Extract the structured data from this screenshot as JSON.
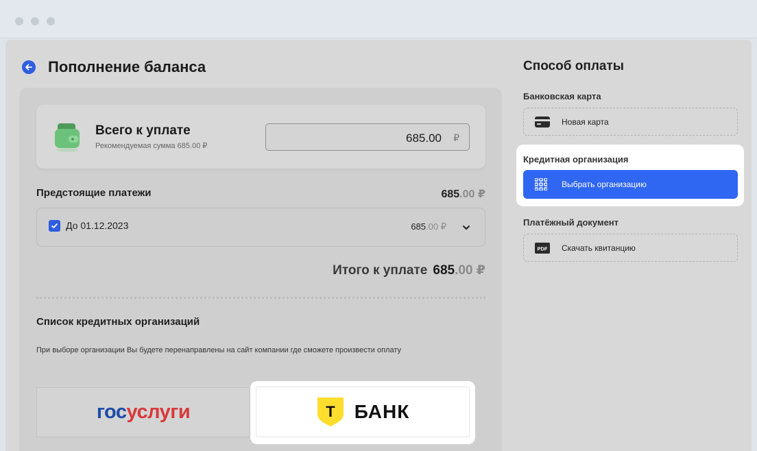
{
  "window": {
    "controls": [
      "close",
      "minimize",
      "maximize"
    ]
  },
  "colors": {
    "accent": "#2f66f2",
    "brand_blue": "#1e4aa8",
    "brand_red": "#d9393a",
    "tbank_yellow": "#ffdd2d"
  },
  "header": {
    "title": "Пополнение баланса",
    "back_icon": "arrow-left-icon"
  },
  "total_card": {
    "icon": "wallet-icon",
    "title": "Всего к уплате",
    "subtitle": "Рекомендуемая сумма 685.00 ₽",
    "amount_value": "685.00",
    "amount_currency": "₽"
  },
  "upcoming": {
    "label": "Предстоящие платежи",
    "total_int": "685",
    "total_dec": ".00 ₽",
    "items": [
      {
        "checked": true,
        "date": "До 01.12.2023",
        "amount_int": "685",
        "amount_dec": ".00 ₽"
      }
    ]
  },
  "grand_total": {
    "label": "Итого к уплате",
    "amount_int": "685",
    "amount_dec": ".00 ₽"
  },
  "orgs": {
    "title": "Список кредитных организаций",
    "description": "При выборе организации Вы будете перенаправлены на сайт компании где сможете произвести оплату",
    "gosuslugi_part1": "гос",
    "gosuslugi_part2": "услуги",
    "tbank_shield_letter": "Т",
    "tbank_text": "БАНК"
  },
  "payment_method": {
    "title": "Способ оплаты",
    "bank_card_label": "Банковская карта",
    "new_card_label": "Новая карта",
    "credit_org_label": "Кредитная организация",
    "choose_org_label": "Выбрать организацию",
    "payment_doc_label": "Платёжный документ",
    "pdf_badge": "PDF",
    "download_receipt_label": "Скачать квитанцию"
  }
}
